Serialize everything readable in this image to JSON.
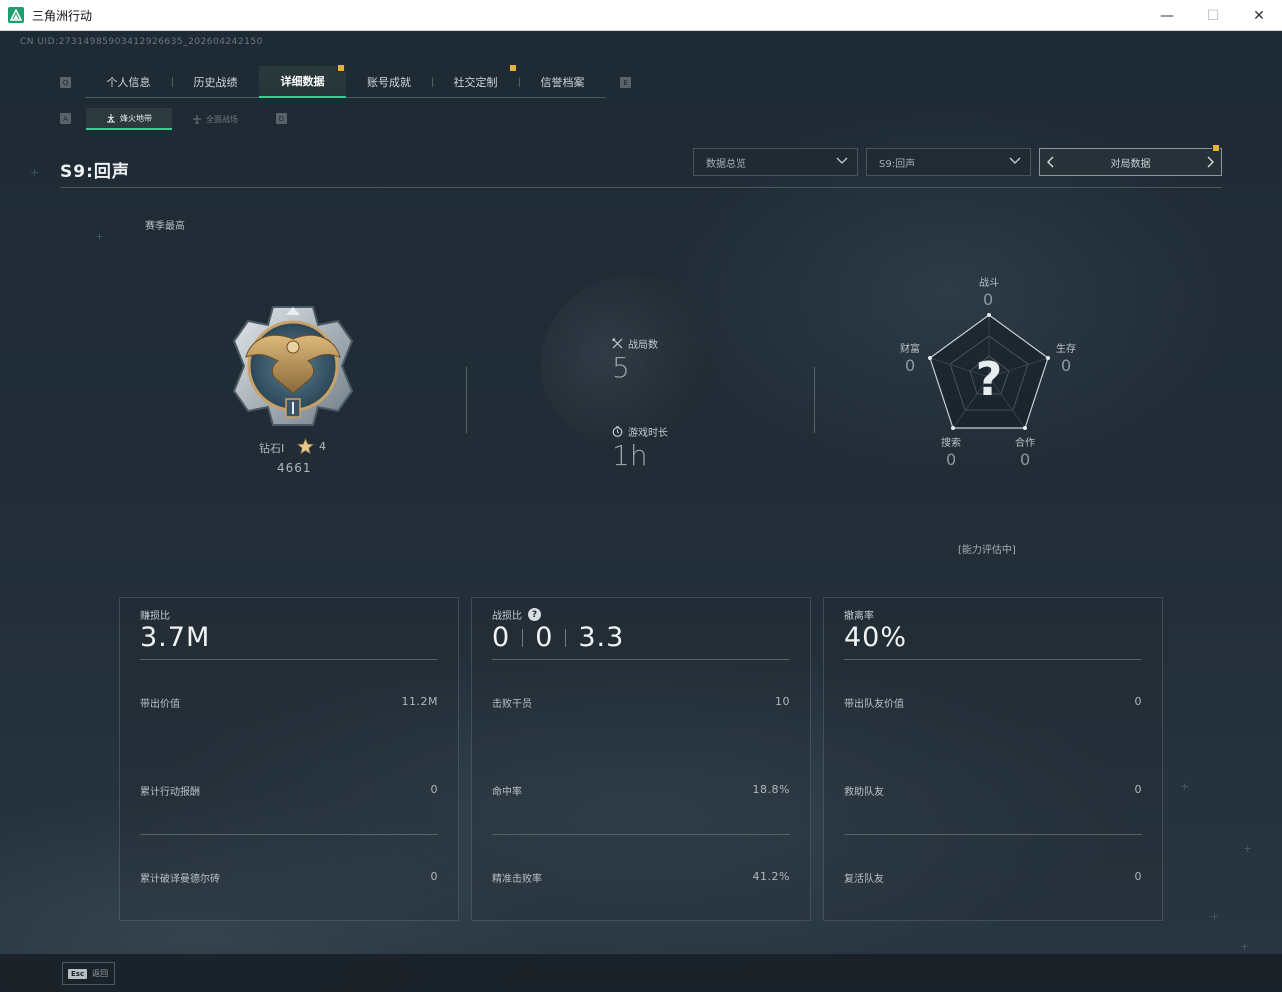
{
  "window": {
    "title": "三角洲行动",
    "minimize": "—",
    "maximize": "☐",
    "close": "✕"
  },
  "uid": "CN UID:27314985903412926635_202604242150",
  "key_hints": {
    "tabs_left": "Q",
    "tabs_right": "E",
    "sub_left": "A",
    "sub_right": "D"
  },
  "tabs": [
    {
      "label": "个人信息",
      "active": false,
      "badge": false
    },
    {
      "label": "历史战绩",
      "active": false,
      "badge": false
    },
    {
      "label": "详细数据",
      "active": true,
      "badge": true
    },
    {
      "label": "账号成就",
      "active": false,
      "badge": false
    },
    {
      "label": "社交定制",
      "active": false,
      "badge": true
    },
    {
      "label": "信誉档案",
      "active": false,
      "badge": false
    }
  ],
  "subtabs": [
    {
      "label": "烽火地带",
      "active": true
    },
    {
      "label": "全面战场",
      "active": false
    }
  ],
  "header": {
    "season_title": "S9:回声",
    "dropdown_overview": "数据总览",
    "dropdown_season": "S9:回声",
    "match_data": "对局数据"
  },
  "season_best": "赛季最高",
  "rank": {
    "name": "钻石I",
    "stars": "4",
    "score": "4661"
  },
  "stats": {
    "matches_label": "战局数",
    "matches_value": "5",
    "playtime_label": "游戏时长",
    "playtime_value": "1h"
  },
  "radar": {
    "combat_label": "战斗",
    "combat_value": "0",
    "survival_label": "生存",
    "survival_value": "0",
    "cooperation_label": "合作",
    "cooperation_value": "0",
    "search_label": "搜索",
    "search_value": "0",
    "wealth_label": "财富",
    "wealth_value": "0",
    "status": "[能力评估中]",
    "placeholder": "?"
  },
  "cards": [
    {
      "title": "赚损比",
      "big": "3.7M",
      "rows": [
        {
          "label": "带出价值",
          "value": "11.2M"
        },
        {
          "label": "累计行动报酬",
          "value": "0"
        },
        {
          "label": "累计破译曼德尔砖",
          "value": "0"
        }
      ]
    },
    {
      "title": "战损比",
      "big_parts": [
        "0",
        "0",
        "3.3"
      ],
      "help": "?",
      "rows": [
        {
          "label": "击败干员",
          "value": "10"
        },
        {
          "label": "命中率",
          "value": "18.8%"
        },
        {
          "label": "精准击败率",
          "value": "41.2%"
        }
      ]
    },
    {
      "title": "撤离率",
      "big": "40%",
      "rows": [
        {
          "label": "带出队友价值",
          "value": "0"
        },
        {
          "label": "救助队友",
          "value": "0"
        },
        {
          "label": "复活队友",
          "value": "0"
        }
      ]
    }
  ],
  "footer": {
    "esc_key": "Esc",
    "esc_label": "返回"
  },
  "colors": {
    "accent": "#2fd092",
    "badge": "#e2b33c",
    "background": "#1e2a34"
  }
}
